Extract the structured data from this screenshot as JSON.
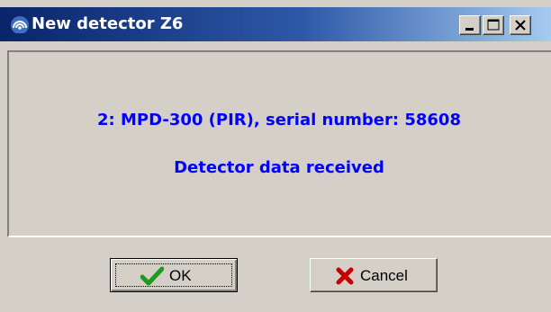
{
  "window": {
    "title": "New detector Z6",
    "icon": "wifi-signal-icon"
  },
  "controls": {
    "minimize_icon": "minimize-icon",
    "maximize_icon": "maximize-icon",
    "close_icon": "close-icon"
  },
  "message": {
    "line1": "2: MPD-300 (PIR), serial number: 58608",
    "line2": "Detector data received",
    "color": "#0000ff"
  },
  "buttons": {
    "ok_label": "OK",
    "ok_icon": "checkmark-icon",
    "cancel_label": "Cancel",
    "cancel_icon": "x-icon"
  }
}
